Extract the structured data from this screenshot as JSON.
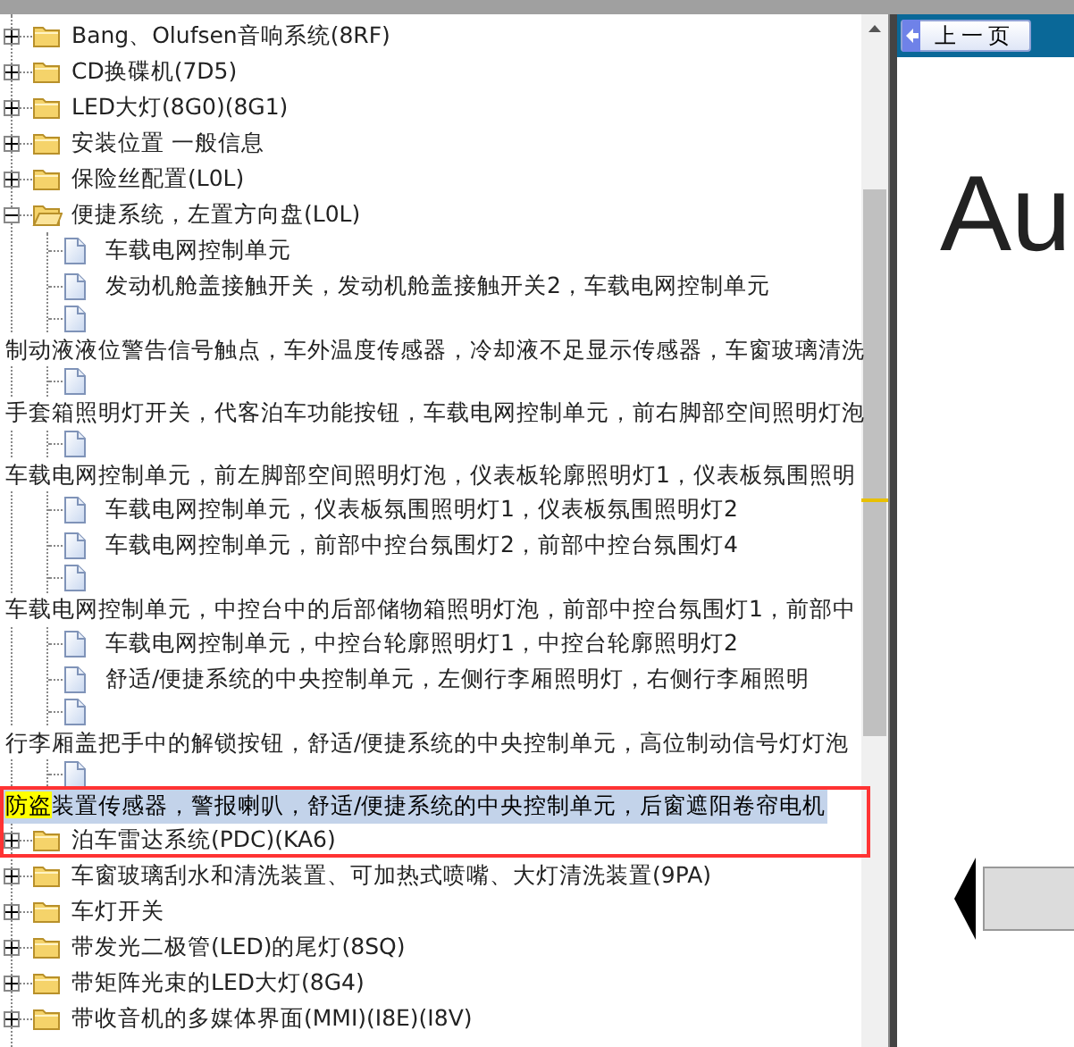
{
  "tree": {
    "items": [
      {
        "kind": "folder",
        "label": "Bang、Olufsen音响系统(8RF)",
        "expanded": false
      },
      {
        "kind": "folder",
        "label": "CD换碟机(7D5)",
        "expanded": false
      },
      {
        "kind": "folder",
        "label": "LED大灯(8G0)(8G1)",
        "expanded": false
      },
      {
        "kind": "folder",
        "label": "安装位置 一般信息",
        "expanded": false
      },
      {
        "kind": "folder",
        "label": "保险丝配置(L0L)",
        "expanded": false
      },
      {
        "kind": "folder",
        "label": "便捷系统，左置方向盘(L0L)",
        "expanded": true,
        "children": [
          {
            "kind": "doc",
            "label": "车载电网控制单元",
            "selected": false,
            "outlined": false
          },
          {
            "kind": "doc",
            "label": "发动机舱盖接触开关，发动机舱盖接触开关2，车载电网控制单元",
            "selected": false,
            "outlined": false
          },
          {
            "kind": "doc",
            "selected": false,
            "outlined": false
          },
          {
            "kind": "line",
            "label": "制动液液位警告信号触点，车外温度传感器，冷却液不足显示传感器，车窗玻璃清洗",
            "selected": false,
            "outlined": false
          },
          {
            "kind": "doc",
            "selected": false,
            "outlined": false
          },
          {
            "kind": "line",
            "label": "手套箱照明灯开关，代客泊车功能按钮，车载电网控制单元，前右脚部空间照明灯泡",
            "selected": false,
            "outlined": false
          },
          {
            "kind": "doc",
            "selected": false,
            "outlined": false
          },
          {
            "kind": "line",
            "label": "车载电网控制单元，前左脚部空间照明灯泡，仪表板轮廓照明灯1，仪表板氛围照明",
            "selected": false,
            "outlined": false
          },
          {
            "kind": "doc",
            "label": "车载电网控制单元，仪表板氛围照明灯1，仪表板氛围照明灯2",
            "selected": false,
            "outlined": false
          },
          {
            "kind": "doc",
            "label": "车载电网控制单元，前部中控台氛围灯2，前部中控台氛围灯4",
            "selected": false,
            "outlined": false
          },
          {
            "kind": "doc",
            "selected": false,
            "outlined": false
          },
          {
            "kind": "line",
            "label": "车载电网控制单元，中控台中的后部储物箱照明灯泡，前部中控台氛围灯1，前部中",
            "selected": false,
            "outlined": false
          },
          {
            "kind": "doc",
            "label": "车载电网控制单元，中控台轮廓照明灯1，中控台轮廓照明灯2",
            "selected": false,
            "outlined": false
          },
          {
            "kind": "doc",
            "label": "舒适/便捷系统的中央控制单元，左侧行李厢照明灯，右侧行李厢照明",
            "selected": false,
            "outlined": false
          },
          {
            "kind": "doc",
            "selected": false,
            "outlined": false
          },
          {
            "kind": "line",
            "label": "行李厢盖把手中的解锁按钮，舒适/便捷系统的中央控制单元，高位制动信号灯灯泡",
            "selected": false,
            "outlined": false
          },
          {
            "kind": "doc",
            "selected": false,
            "outlined": false
          },
          {
            "kind": "line",
            "match": "防盗",
            "label": "装置传感器，警报喇叭，舒适/便捷系统的中央控制单元，后窗遮阳卷帘电机",
            "selected": true,
            "outlined": true
          }
        ]
      },
      {
        "kind": "folder",
        "label": "泊车雷达系统(PDC)(KA6)",
        "expanded": false
      },
      {
        "kind": "folder",
        "label": "车窗玻璃刮水和清洗装置、可加热式喷嘴、大灯清洗装置(9PA)",
        "expanded": false
      },
      {
        "kind": "folder",
        "label": "车灯开关",
        "expanded": false
      },
      {
        "kind": "folder",
        "label": "带发光二极管(LED)的尾灯(8SQ)",
        "expanded": false
      },
      {
        "kind": "folder",
        "label": "带矩阵光束的LED大灯(8G4)",
        "expanded": false
      },
      {
        "kind": "folder",
        "label": "带收音机的多媒体界面(MMI)(I8E)(I8V)",
        "expanded": false
      }
    ]
  },
  "viewer": {
    "back_button": "上一页",
    "heading": "Au"
  }
}
